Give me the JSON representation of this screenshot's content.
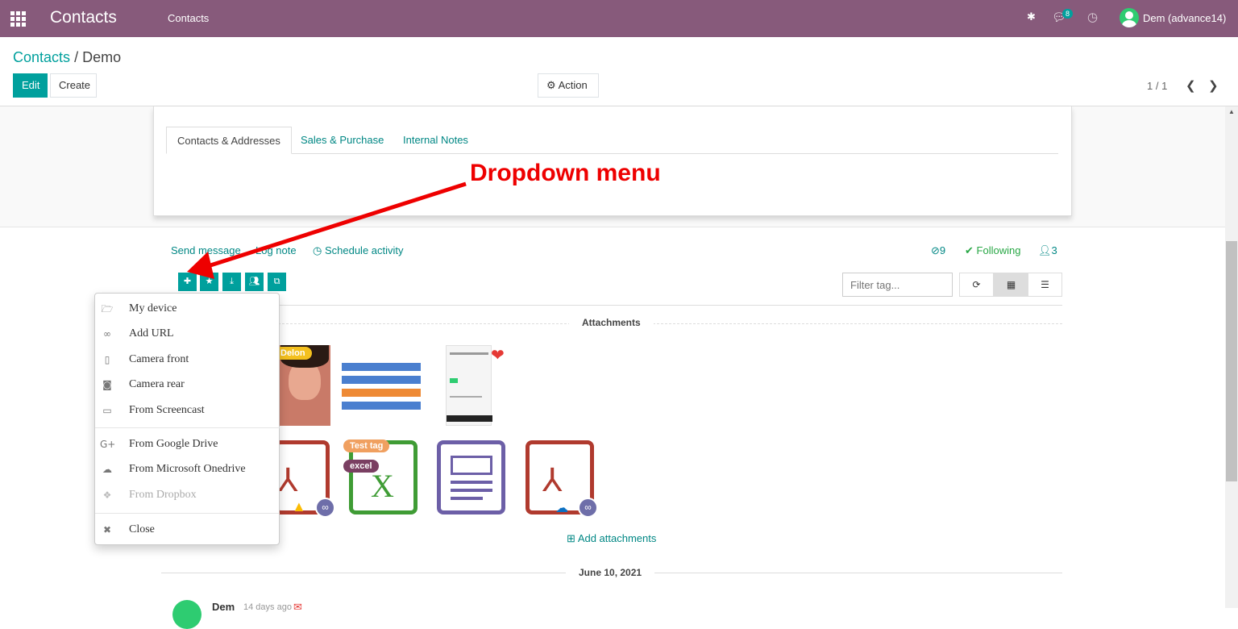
{
  "navbar": {
    "app_name": "Contacts",
    "menu_item": "Contacts",
    "messages_badge": "8",
    "user_name": "Dem (advance14)"
  },
  "breadcrumb": {
    "parent": "Contacts",
    "separator": "/",
    "current": "Demo"
  },
  "buttons": {
    "edit": "Edit",
    "create": "Create",
    "action": "Action"
  },
  "pager": {
    "value": "1 / 1"
  },
  "tabs": [
    "Contacts & Addresses",
    "Sales & Purchase",
    "Internal Notes"
  ],
  "annotation": "Dropdown menu",
  "chatter": {
    "send_message": "Send message",
    "log_note": "Log note",
    "schedule_activity": "Schedule activity",
    "attachment_count": "9",
    "following": "Following",
    "follower_count": "3"
  },
  "filter_tag": {
    "placeholder": "Filter tag..."
  },
  "attachments_header": "Attachments",
  "tags": {
    "delon": "Delon",
    "test_tag": "Test tag",
    "excel": "excel"
  },
  "add_attachments": "Add attachments",
  "date_header": "June 10, 2021",
  "message_author": "Dem",
  "message_time": "14 days ago",
  "dropdown": [
    {
      "icon": "folder-open-icon",
      "label": "My device"
    },
    {
      "icon": "link-icon",
      "label": "Add URL"
    },
    {
      "icon": "mobile-icon",
      "label": "Camera front"
    },
    {
      "icon": "camera-icon",
      "label": "Camera rear"
    },
    {
      "icon": "desktop-icon",
      "label": "From Screencast"
    },
    {
      "icon": "google-plus-icon",
      "label": "From Google Drive"
    },
    {
      "icon": "cloud-icon",
      "label": "From Microsoft Onedrive"
    },
    {
      "icon": "dropbox-icon",
      "label": "From Dropbox"
    },
    {
      "icon": "close-icon",
      "label": "Close"
    }
  ],
  "colors": {
    "brand": "#875a7b",
    "accent": "#00a09d",
    "annotation": "#ee0000"
  }
}
